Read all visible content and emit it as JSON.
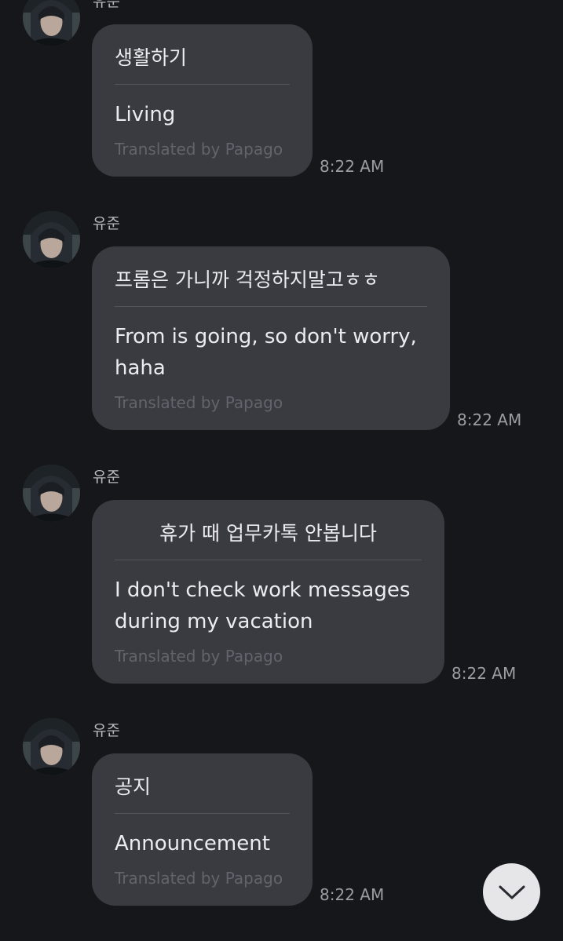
{
  "messages": [
    {
      "sender": "유준",
      "original": "생활하기",
      "translation": "Living",
      "credit": "Translated by Papago",
      "time": "8:22 AM"
    },
    {
      "sender": "유준",
      "original": "프롬은 가니까 걱정하지말고ㅎㅎ",
      "translation": "From is going, so don't worry, haha",
      "credit": "Translated by Papago",
      "time": "8:22 AM"
    },
    {
      "sender": "유준",
      "original": "휴가 때 업무카톡 안봅니다",
      "translation": "I don't check work messages during my vacation",
      "credit": "Translated by Papago",
      "time": "8:22 AM"
    },
    {
      "sender": "유준",
      "original": "공지",
      "translation": "Announcement",
      "credit": "Translated by Papago",
      "time": "8:22 AM"
    }
  ],
  "scroll_button": {
    "icon": "chevron-down-icon"
  },
  "colors": {
    "background": "#16171b",
    "bubble": "#3a3b41",
    "scroll_button": "#e6e6e8"
  }
}
